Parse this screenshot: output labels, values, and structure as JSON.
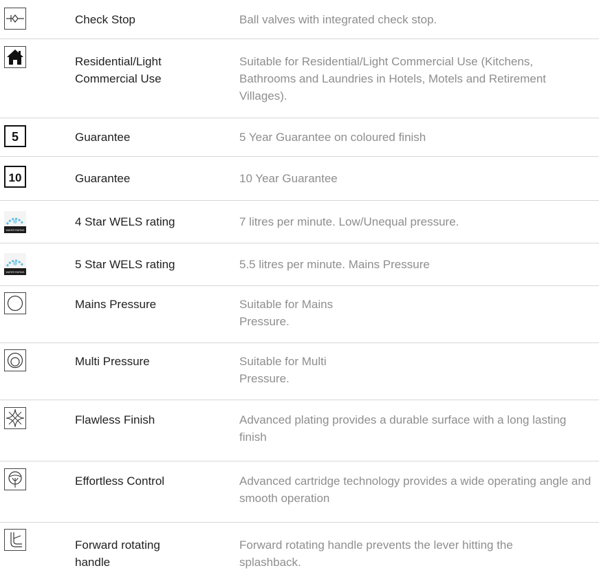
{
  "features": [
    {
      "icon": "check-stop-icon",
      "name": "Check Stop",
      "description": "Ball valves with integrated check stop."
    },
    {
      "icon": "house-icon",
      "name": "Residential/Light Commercial Use",
      "description": "Suitable for Residential/Light Commercial Use (Kitchens, Bathrooms and Laundries in Hotels, Motels and Retirement Villages)."
    },
    {
      "icon": "guarantee-5-icon",
      "icon_text": "5",
      "name": "Guarantee",
      "description": "5 Year Guarantee on coloured finish"
    },
    {
      "icon": "guarantee-10-icon",
      "icon_text": "10",
      "name": "Guarantee",
      "description": "10 Year Guarantee"
    },
    {
      "icon": "water-rating-icon",
      "icon_text": "WATER RATING",
      "name": "4 Star WELS rating",
      "description": "7 litres per minute. Low/Unequal pressure."
    },
    {
      "icon": "water-rating-icon",
      "icon_text": "WATER RATING",
      "name": "5 Star WELS rating",
      "description": "5.5 litres per minute. Mains Pressure"
    },
    {
      "icon": "circle-icon",
      "name": "Mains Pressure",
      "description_lines": [
        "Suitable for Mains",
        "Pressure."
      ]
    },
    {
      "icon": "double-circle-icon",
      "name": "Multi Pressure",
      "description_lines": [
        "Suitable for Multi",
        "Pressure."
      ]
    },
    {
      "icon": "sparkle-icon",
      "name": "Flawless Finish",
      "description": "Advanced plating provides a durable surface with a long lasting finish"
    },
    {
      "icon": "cartridge-control-icon",
      "name": "Effortless Control",
      "description": "Advanced cartridge technology provides a wide operating angle and smooth operation"
    },
    {
      "icon": "forward-handle-icon",
      "name": "Forward rotating handle",
      "description": "Forward rotating handle prevents the lever hitting the splashback."
    }
  ]
}
